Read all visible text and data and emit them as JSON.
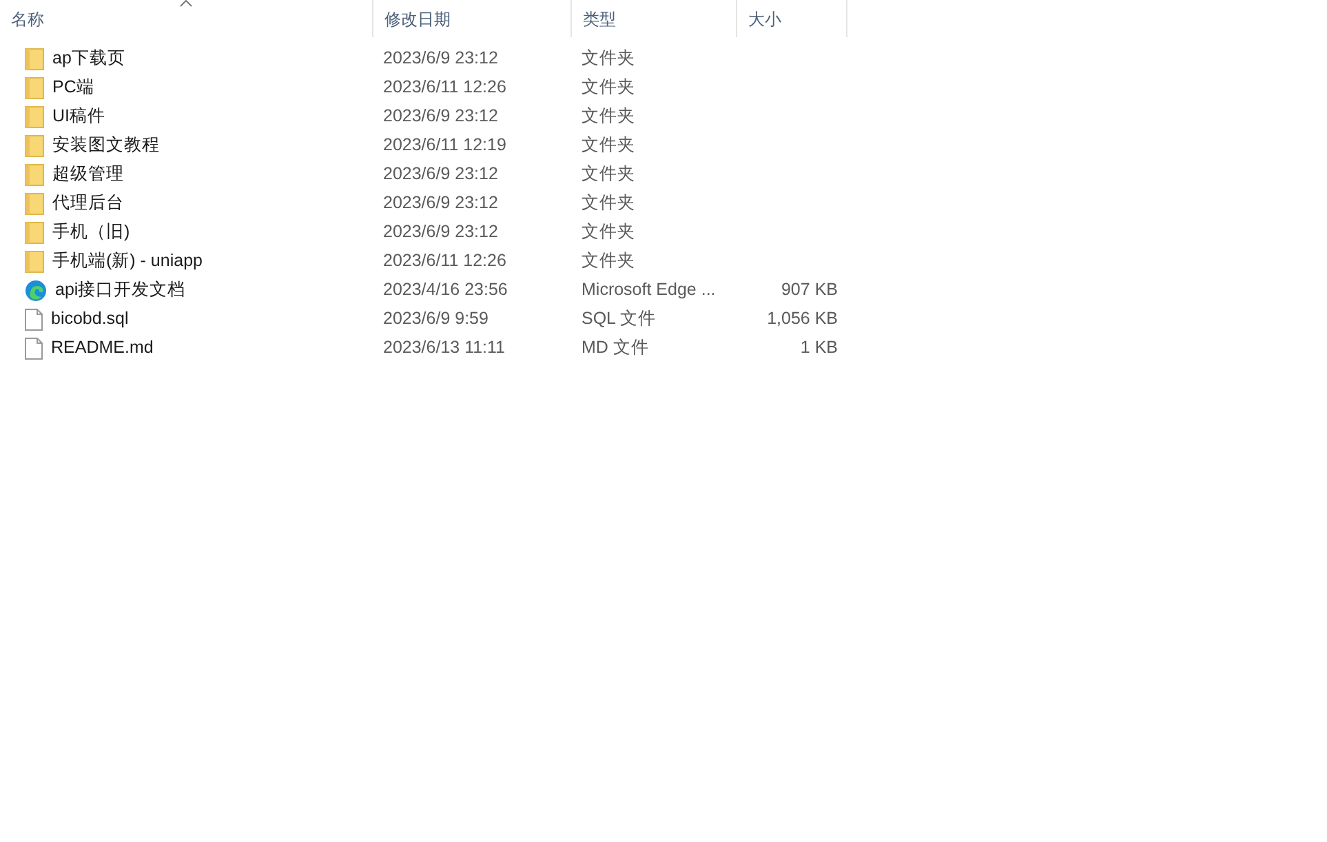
{
  "columns": [
    {
      "label": "名称",
      "sorted": true
    },
    {
      "label": "修改日期",
      "sorted": false
    },
    {
      "label": "类型",
      "sorted": false
    },
    {
      "label": "大小",
      "sorted": false
    }
  ],
  "rows": [
    {
      "kind": "folder",
      "name": "ap下载页",
      "date": "2023/6/9 23:12",
      "type": "文件夹"
    },
    {
      "kind": "folder",
      "name": "PC端",
      "date": "2023/6/11 12:26",
      "type": "文件夹"
    },
    {
      "kind": "folder",
      "name": "UI稿件",
      "date": "2023/6/9 23:12",
      "type": "文件夹"
    },
    {
      "kind": "folder",
      "name": "安装图文教程",
      "date": "2023/6/11 12:19",
      "type": "文件夹"
    },
    {
      "kind": "folder",
      "name": "超级管理",
      "date": "2023/6/9 23:12",
      "type": "文件夹"
    },
    {
      "kind": "folder",
      "name": "代理后台",
      "date": "2023/6/9 23:12",
      "type": "文件夹"
    },
    {
      "kind": "folder",
      "name": "手机（旧)",
      "date": "2023/6/9 23:12",
      "type": "文件夹"
    },
    {
      "kind": "folder",
      "name": "手机端(新) - uniapp",
      "date": "2023/6/11 12:26",
      "type": "文件夹"
    },
    {
      "kind": "edge",
      "name": "api接口开发文档",
      "date": "2023/4/16 23:56",
      "type": "Microsoft Edge ...",
      "size": "907 KB"
    },
    {
      "kind": "file",
      "name": "bicobd.sql",
      "date": "2023/6/9 9:59",
      "type": "SQL 文件",
      "size": "1,056 KB"
    },
    {
      "kind": "file",
      "name": "README.md",
      "date": "2023/6/13 11:11",
      "type": "MD 文件",
      "size": "1 KB"
    }
  ]
}
